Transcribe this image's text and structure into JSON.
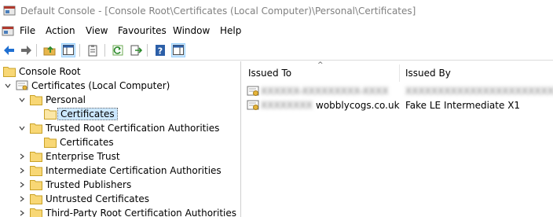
{
  "window": {
    "title": "Default Console - [Console Root\\Certificates (Local Computer)\\Personal\\Certificates]"
  },
  "menu": {
    "items": [
      "File",
      "Action",
      "View",
      "Favourites",
      "Window",
      "Help"
    ]
  },
  "toolbar": {
    "buttons": [
      {
        "icon": "back-arrow-icon"
      },
      {
        "icon": "forward-arrow-icon"
      },
      {
        "icon": "up-folder-icon"
      },
      {
        "icon": "show-hide-console-tree-icon",
        "active": true
      },
      {
        "icon": "properties-icon"
      },
      {
        "icon": "refresh-icon"
      },
      {
        "icon": "export-list-icon"
      },
      {
        "icon": "help-icon"
      },
      {
        "icon": "show-action-pane-icon",
        "active": true
      }
    ]
  },
  "tree": {
    "items": [
      {
        "label": "Console Root"
      },
      {
        "label": "Certificates (Local Computer)",
        "expanded": true
      },
      {
        "label": "Personal",
        "expanded": true
      },
      {
        "label": "Certificates",
        "selected": true
      },
      {
        "label": "Trusted Root Certification Authorities",
        "expanded": true
      },
      {
        "label": "Certificates"
      },
      {
        "label": "Enterprise Trust"
      },
      {
        "label": "Intermediate Certification Authorities"
      },
      {
        "label": "Trusted Publishers"
      },
      {
        "label": "Untrusted Certificates"
      },
      {
        "label": "Third-Party Root Certification Authorities"
      }
    ]
  },
  "list": {
    "columns": [
      "Issued To",
      "Issued By"
    ],
    "rows": [
      {
        "issued_to_hidden": "XXXXXX-XXXXXXXXX-XXXX",
        "issued_to_visible": "",
        "issued_by": "XXXXXXXXXXXXXXXXXXXXXXXXXX",
        "issued_by_hidden": true
      },
      {
        "issued_to_hidden": "XXXXXXXX",
        "issued_to_visible": "wobblycogs.co.uk",
        "issued_by": "Fake LE Intermediate X1",
        "issued_by_hidden": false
      }
    ]
  },
  "colors": {
    "selection_bg": "#cce8ff",
    "folder_yellow": "#f8d775",
    "title_gray": "#808080"
  }
}
